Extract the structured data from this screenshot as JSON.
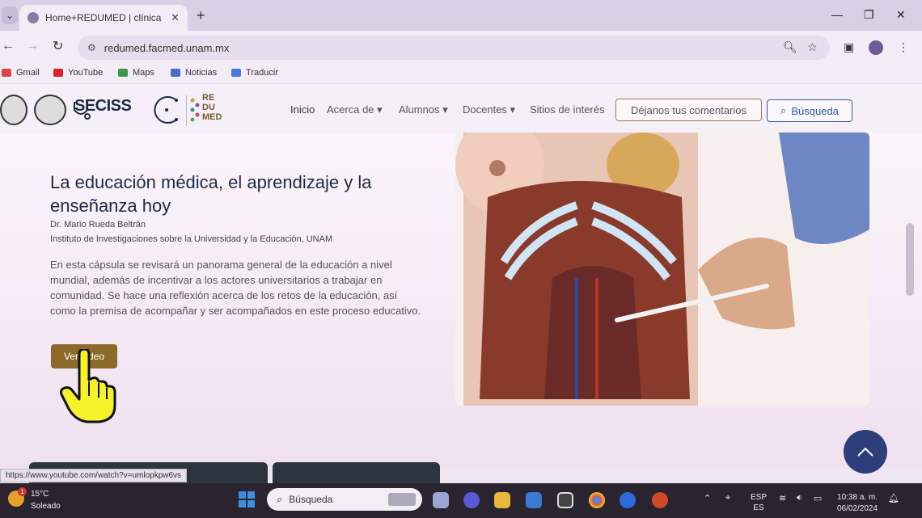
{
  "browser": {
    "tab_title": "Home+REDUMED | clínica",
    "tab_close": "✕",
    "new_tab": "+",
    "url": "redumed.facmed.unam.mx",
    "bookmarks": [
      "Gmail",
      "YouTube",
      "Maps",
      "Noticias",
      "Traducir"
    ]
  },
  "site": {
    "seciss": "SECISS",
    "redumed_logo": [
      "RE",
      "DU",
      "MED"
    ],
    "nav": {
      "inicio": "Inicio",
      "acerca": "Acerca de ▾",
      "alumnos": "Alumnos ▾",
      "docentes": "Docentes ▾",
      "sitios": "Sitios de interés",
      "comentarios": "Déjanos tus comentarios",
      "busqueda": "Búsqueda"
    }
  },
  "hero": {
    "title": "La educación médica, el aprendizaje y la enseñanza hoy",
    "author": "Dr. Mario Rueda Beltrán",
    "institution": "Instituto de Investigaciones sobre la Universidad y la Educación, UNAM",
    "description": "En esta cápsula se revisará un panorama general de la educación a nivel mundial, además de incentivar a los actores universitarios a trabajar en comunidad. Se hace una reflexión acerca de los retos de la educación, así como la premisa de acompañar y ser acompañados en este proceso educativo.",
    "button": "Ver video"
  },
  "status_url": "https://www.youtube.com/watch?v=umlopkpw6vs",
  "taskbar": {
    "temperature": "15°C",
    "condition": "Soleado",
    "weather_badge": "1",
    "search_placeholder": "Búsqueda",
    "lang_top": "ESP",
    "lang_bottom": "ES",
    "time": "10:38 a. m.",
    "date": "06/02/2024"
  },
  "colors": {
    "accent_brown": "#8b6a2a",
    "nav_blue": "#2e5ba8",
    "title_navy": "#1d2a46",
    "scroll_button": "#2d3e7a"
  }
}
